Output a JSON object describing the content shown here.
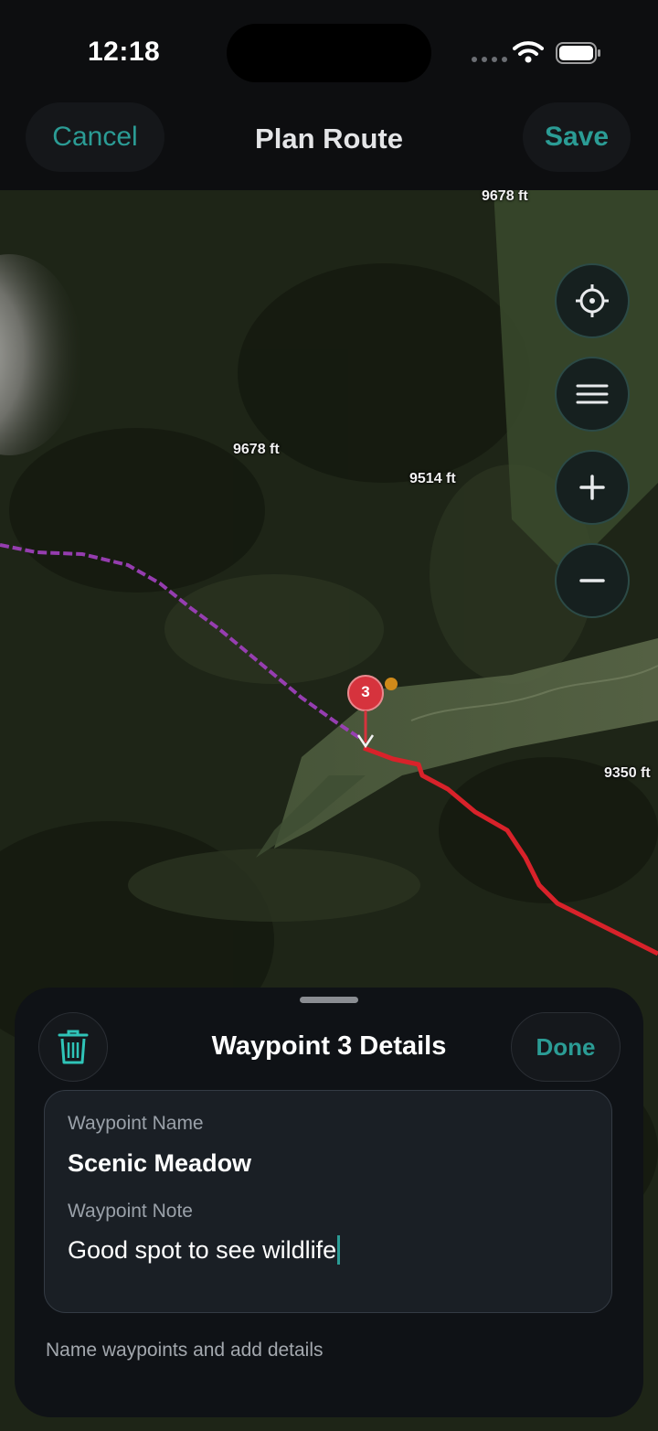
{
  "status_bar": {
    "time": "12:18"
  },
  "nav": {
    "cancel_label": "Cancel",
    "title": "Plan Route",
    "save_label": "Save"
  },
  "map": {
    "elevation_labels": [
      "9678 ft",
      "9678 ft",
      "9514 ft",
      "9350 ft"
    ],
    "waypoint_number": "3",
    "controls": [
      "locate-icon",
      "layers-icon",
      "zoom-in-icon",
      "zoom-out-icon"
    ],
    "route_colors": {
      "planned": "#9c3fb8",
      "active": "#d8222a"
    }
  },
  "sheet": {
    "title": "Waypoint 3 Details",
    "done_label": "Done",
    "name_label": "Waypoint Name",
    "name_value": "Scenic Meadow",
    "note_label": "Waypoint Note",
    "note_value": "Good spot to see wildlife",
    "hint": "Name waypoints and add details"
  },
  "colors": {
    "accent": "#2b9c95",
    "background": "#0d0e10",
    "sheet": "#0f1216"
  }
}
